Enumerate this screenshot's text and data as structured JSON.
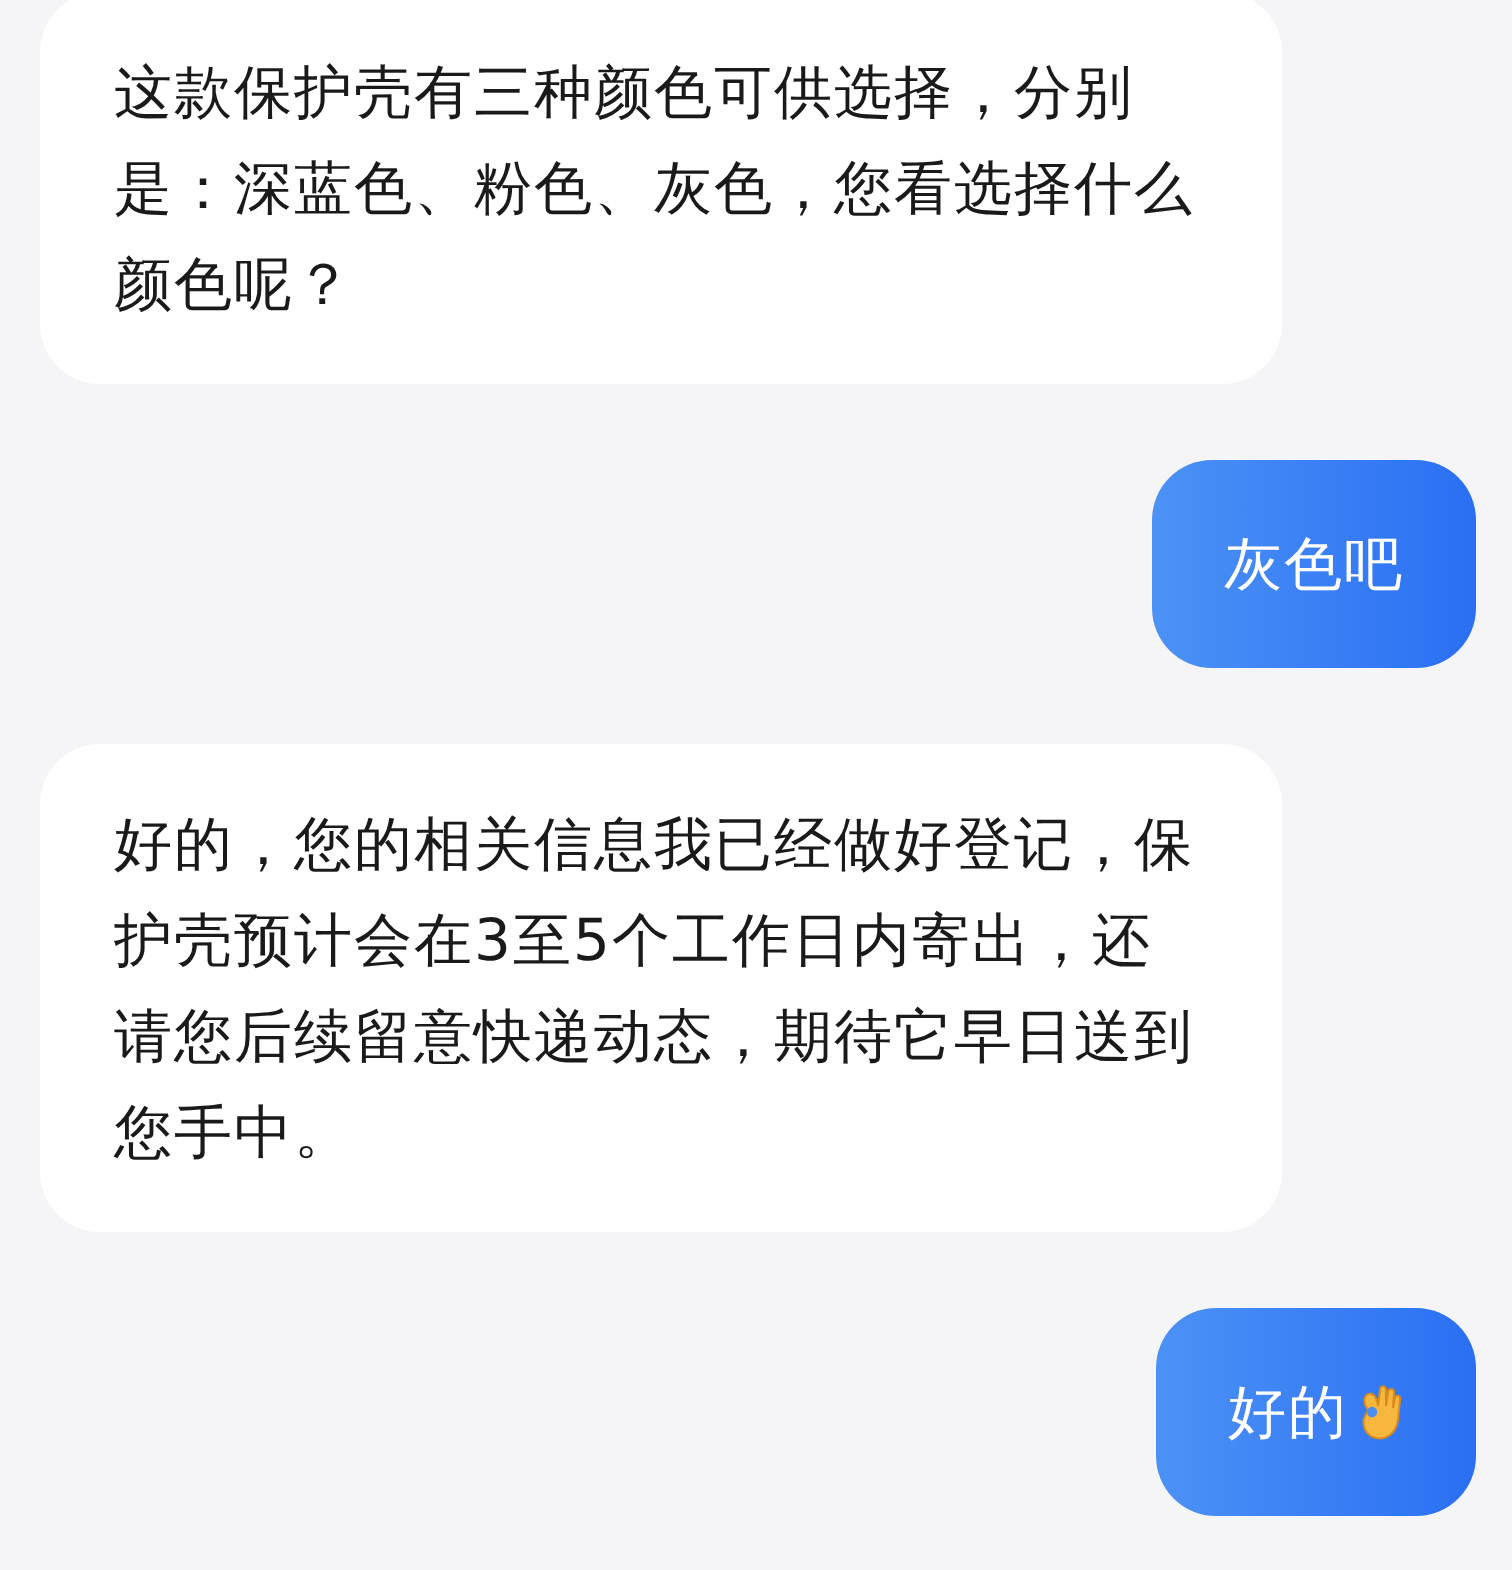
{
  "messages": [
    {
      "kind": "incoming",
      "lines": [
        "这款保护壳有三种颜色可供选择，分别",
        "是：深蓝色、粉色、灰色，您看选择什么",
        "颜色呢？"
      ]
    },
    {
      "kind": "outgoing",
      "lines": [
        "灰色吧"
      ]
    },
    {
      "kind": "incoming",
      "lines": [
        "好的，您的相关信息我已经做好登记，保",
        "护壳预计会在3至5个工作日内寄出，还",
        "请您后续留意快递动态，期待它早日送到",
        "您手中。"
      ]
    },
    {
      "kind": "outgoing",
      "lines": [
        "好的"
      ],
      "ok_hand": true
    }
  ]
}
